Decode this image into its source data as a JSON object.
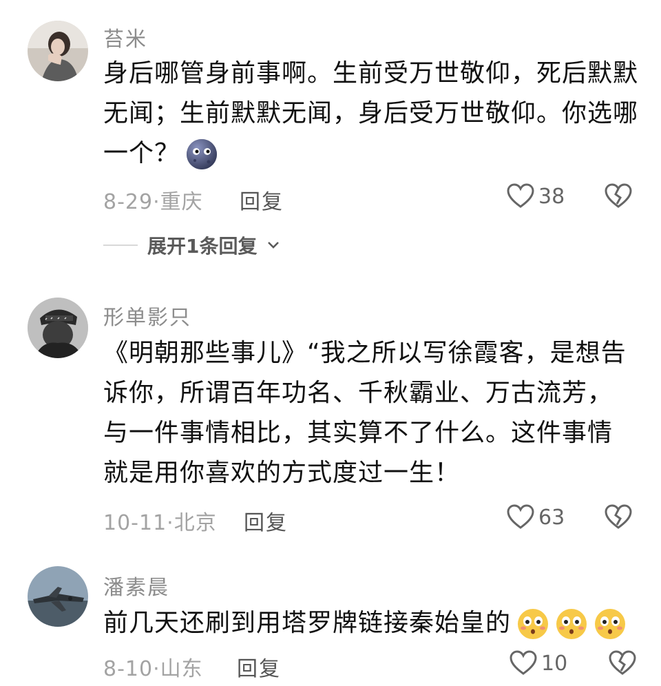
{
  "comments": [
    {
      "username": "苔米",
      "text": "身后哪管身前事啊。生前受万世敬仰，死后默默无闻；生前默默无闻，身后受万世敬仰。你选哪一个？",
      "date_location": "8-29·重庆",
      "reply_label": "回复",
      "likes": "38",
      "emoji": "new-moon-face"
    },
    {
      "username": "形单影只",
      "text": "《明朝那些事儿》“我之所以写徐霞客，是想告诉你，所谓百年功名、千秋霸业、万古流芳，与一件事情相比，其实算不了什么。这件事情就是用你喜欢的方式度过一生！",
      "date_location": "10-11·北京",
      "reply_label": "回复",
      "likes": "63"
    },
    {
      "username": "潘素晨",
      "text": "前几天还刷到用塔罗牌链接秦始皇的",
      "date_location": "8-10·山东",
      "reply_label": "回复",
      "likes": "10",
      "emoji": "flushed-face"
    }
  ],
  "expand_replies": {
    "label": "展开1条回复"
  },
  "colors": {
    "username": "#8c8c8c",
    "meta": "#a3a3a3",
    "text": "#111111"
  }
}
